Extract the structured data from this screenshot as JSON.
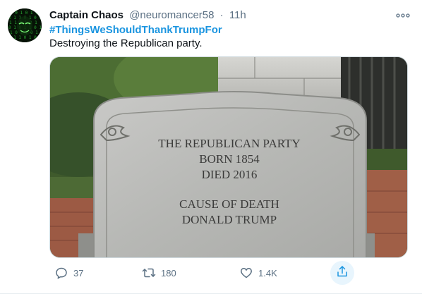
{
  "tweet": {
    "author_name": "Captain Chaos",
    "handle": "@neuromancer58",
    "separator": "·",
    "time": "11h",
    "hashtag": "#ThingsWeShouldThankTrumpFor",
    "text": "Destroying the Republican party.",
    "image": {
      "lines": [
        "THE REPUBLICAN PARTY",
        "BORN 1854",
        "DIED 2016",
        "CAUSE OF DEATH",
        "DONALD TRUMP"
      ]
    },
    "actions": {
      "replies": "37",
      "retweets": "180",
      "likes": "1.4K"
    }
  },
  "icons": {
    "more": "more-icon",
    "reply": "reply-icon",
    "retweet": "retweet-icon",
    "like": "heart-icon",
    "share": "share-icon"
  },
  "colors": {
    "link": "#1b95e0",
    "secondary_text": "#5b7083",
    "share_highlight": "#e8f5fd"
  }
}
